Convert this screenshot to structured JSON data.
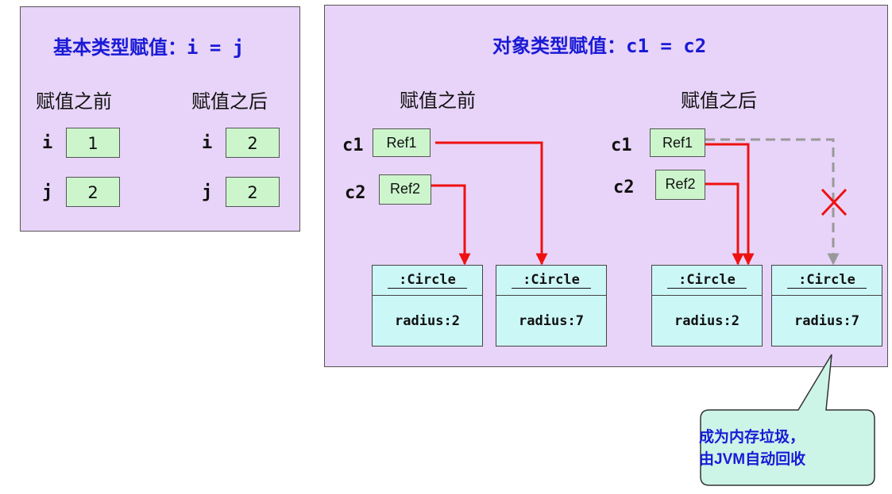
{
  "left": {
    "title_cn": "基本类型赋值：",
    "title_code": "i = j",
    "before_label": "赋值之前",
    "after_label": "赋值之后",
    "before": {
      "i": {
        "name": "i",
        "value": "1"
      },
      "j": {
        "name": "j",
        "value": "2"
      }
    },
    "after": {
      "i": {
        "name": "i",
        "value": "2"
      },
      "j": {
        "name": "j",
        "value": "2"
      }
    }
  },
  "right": {
    "title_cn": "对象类型赋值：",
    "title_code": "c1 = c2",
    "before_label": "赋值之前",
    "after_label": "赋值之后",
    "before": {
      "c1": {
        "name": "c1",
        "ref": "Ref1"
      },
      "c2": {
        "name": "c2",
        "ref": "Ref2"
      },
      "objects": [
        {
          "class": ":Circle",
          "attr": "radius:2"
        },
        {
          "class": ":Circle",
          "attr": "radius:7"
        }
      ]
    },
    "after": {
      "c1": {
        "name": "c1",
        "ref": "Ref1"
      },
      "c2": {
        "name": "c2",
        "ref": "Ref2"
      },
      "objects": [
        {
          "class": ":Circle",
          "attr": "radius:2"
        },
        {
          "class": ":Circle",
          "attr": "radius:7"
        }
      ]
    }
  },
  "callout": {
    "line1_cn": "成为内存垃圾，",
    "line2_prefix": "由",
    "line2_bold": "JVM",
    "line2_suffix": "自动回收"
  },
  "colors": {
    "panel_bg": "#e8d4f8",
    "value_box": "#ccf5cc",
    "object_box": "#ccf7f7",
    "title_blue": "#1a1ad6",
    "arrow_red": "#ee1111",
    "arrow_gray": "#999999",
    "callout_bg": "#ccf5e8"
  }
}
